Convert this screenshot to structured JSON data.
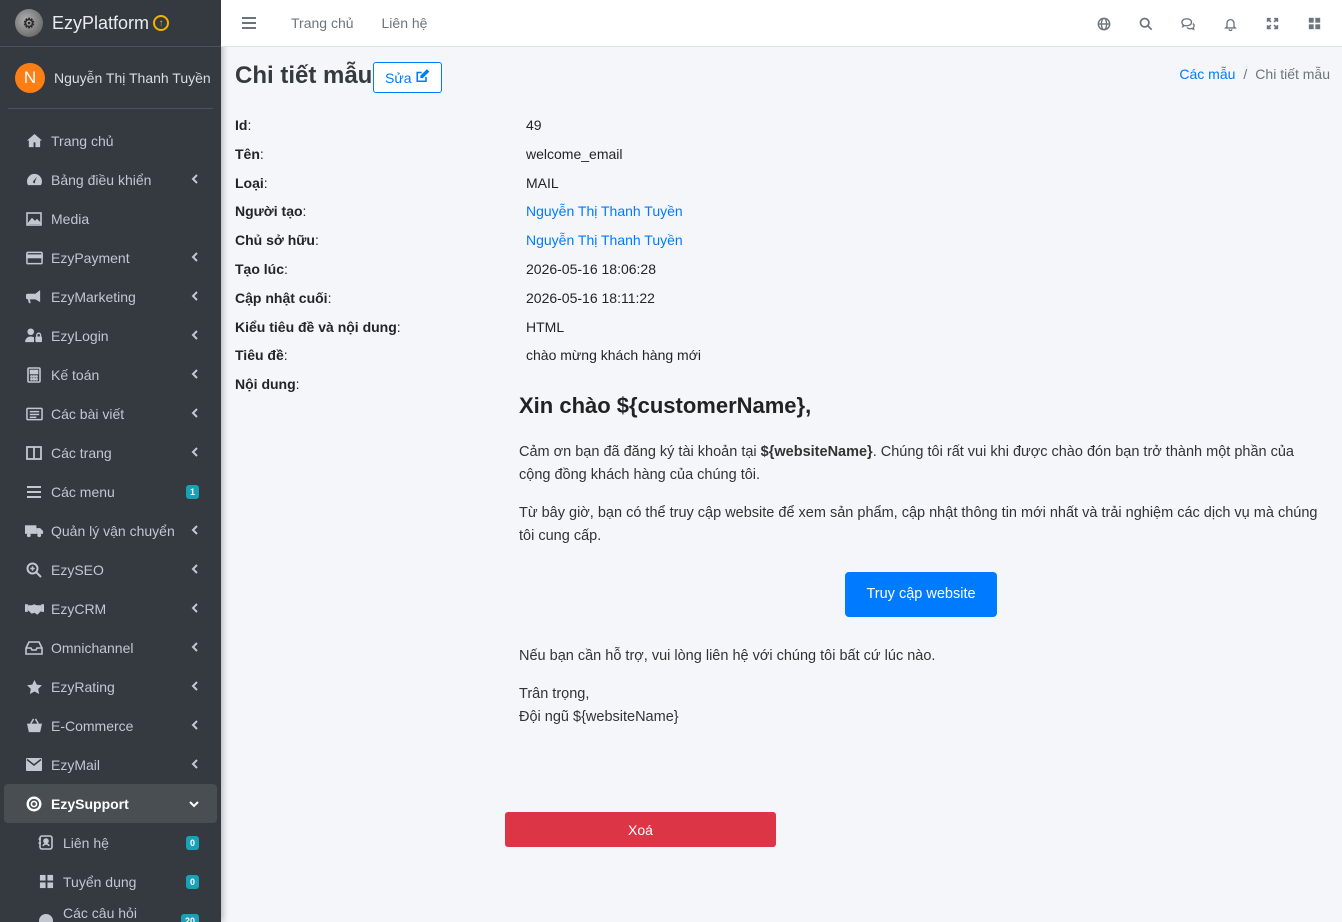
{
  "brand": {
    "name": "EzyPlatform",
    "logo_icon": "gear-logo-icon",
    "upgrade_icon": "arrow-up-circle-icon"
  },
  "user": {
    "initial": "N",
    "name": "Nguyễn Thị Thanh Tuyền"
  },
  "sidebar": {
    "items": [
      {
        "label": "Trang chủ",
        "icon": "home-icon",
        "chevron": false
      },
      {
        "label": "Bảng điều khiển",
        "icon": "tachometer-icon",
        "chevron": true
      },
      {
        "label": "Media",
        "icon": "image-icon",
        "chevron": false
      },
      {
        "label": "EzyPayment",
        "icon": "credit-card-icon",
        "chevron": true
      },
      {
        "label": "EzyMarketing",
        "icon": "bullhorn-icon",
        "chevron": true
      },
      {
        "label": "EzyLogin",
        "icon": "user-lock-icon",
        "chevron": true
      },
      {
        "label": "Kế toán",
        "icon": "calculator-icon",
        "chevron": true
      },
      {
        "label": "Các bài viết",
        "icon": "newspaper-icon",
        "chevron": true
      },
      {
        "label": "Các trang",
        "icon": "columns-icon",
        "chevron": true
      },
      {
        "label": "Các menu",
        "icon": "bars-icon",
        "badge": "1"
      },
      {
        "label": "Quản lý vận chuyển",
        "icon": "truck-icon",
        "chevron": true
      },
      {
        "label": "EzySEO",
        "icon": "search-plus-icon",
        "chevron": true
      },
      {
        "label": "EzyCRM",
        "icon": "handshake-icon",
        "chevron": true
      },
      {
        "label": "Omnichannel",
        "icon": "inbox-icon",
        "chevron": true
      },
      {
        "label": "EzyRating",
        "icon": "star-icon",
        "chevron": true
      },
      {
        "label": "E-Commerce",
        "icon": "basket-icon",
        "chevron": true
      },
      {
        "label": "EzyMail",
        "icon": "envelope-icon",
        "chevron": true
      },
      {
        "label": "EzySupport",
        "icon": "life-ring-icon",
        "chevron": "down",
        "active": true
      }
    ],
    "sub_items": [
      {
        "label": "Liên hệ",
        "icon": "contact-icon",
        "badge": "0"
      },
      {
        "label": "Tuyển dụng",
        "icon": "th-large-icon",
        "badge": "0"
      },
      {
        "label": "Các câu hỏi thường",
        "icon": "question-circle-icon",
        "badge": "20"
      }
    ]
  },
  "topbar": {
    "links": [
      "Trang chủ",
      "Liên hệ"
    ],
    "icons": [
      "globe-icon",
      "search-icon",
      "comments-icon",
      "bell-icon",
      "expand-icon",
      "th-large-icon"
    ]
  },
  "page": {
    "title": "Chi tiết mẫu",
    "edit_label": "Sửa",
    "breadcrumb": {
      "parent": "Các mẫu",
      "current": "Chi tiết mẫu"
    }
  },
  "details": [
    {
      "label": "Id",
      "value": "49",
      "link": false
    },
    {
      "label": "Tên",
      "value": "welcome_email",
      "link": false
    },
    {
      "label": "Loại",
      "value": "MAIL",
      "link": false
    },
    {
      "label": "Người tạo",
      "value": "Nguyễn Thị Thanh Tuyền",
      "link": true
    },
    {
      "label": "Chủ sở hữu",
      "value": "Nguyễn Thị Thanh Tuyền",
      "link": true
    },
    {
      "label": "Tạo lúc",
      "value": "2026-05-16 18:06:28",
      "link": false
    },
    {
      "label": "Cập nhật cuối",
      "value": "2026-05-16 18:11:22",
      "link": false
    },
    {
      "label": "Kiểu tiêu đề và nội dung",
      "value": "HTML",
      "link": false
    },
    {
      "label": "Tiêu đề",
      "value": "chào mừng khách hàng mới",
      "link": false
    },
    {
      "label": "Nội dung",
      "value": "",
      "link": false
    }
  ],
  "email": {
    "heading": "Xin chào ${customerName},",
    "p1_before": "Cảm ơn bạn đã đăng ký tài khoản tại ",
    "p1_bold": "${websiteName}",
    "p1_after": ". Chúng tôi rất vui khi được chào đón bạn trở thành một phần của cộng đồng khách hàng của chúng tôi.",
    "p2": "Từ bây giờ, bạn có thể truy cập website để xem sản phẩm, cập nhật thông tin mới nhất và trải nghiệm các dịch vụ mà chúng tôi cung cấp.",
    "cta": "Truy cập website",
    "p3": "Nếu bạn cần hỗ trợ, vui lòng liên hệ với chúng tôi bất cứ lúc nào.",
    "signoff": "Trân trọng,",
    "team": "Đội ngũ ${websiteName}"
  },
  "delete_label": "Xoá",
  "colors": {
    "sidebar_bg": "#343a40",
    "primary": "#007bff",
    "danger": "#dc3545",
    "badge": "#17a2b8",
    "avatar": "#fd7e14"
  }
}
